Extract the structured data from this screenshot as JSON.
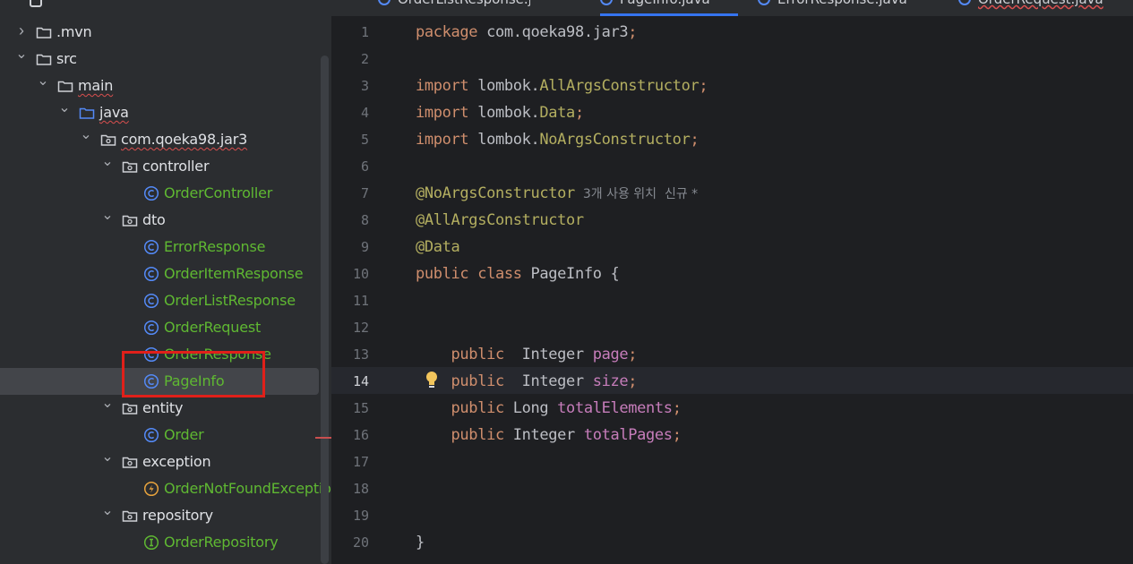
{
  "sidebar": {
    "tree": [
      {
        "label": ".mvn",
        "type": "folder",
        "depth": 0,
        "expanded": false
      },
      {
        "label": "src",
        "type": "folder",
        "depth": 0,
        "expanded": true
      },
      {
        "label": "main",
        "type": "folder",
        "depth": 1,
        "expanded": true,
        "underline": true
      },
      {
        "label": "java",
        "type": "source-folder",
        "depth": 2,
        "expanded": true,
        "underline": true
      },
      {
        "label": "com.qoeka98.jar3",
        "type": "package",
        "depth": 3,
        "expanded": true,
        "underline": true
      },
      {
        "label": "controller",
        "type": "package",
        "depth": 4,
        "expanded": true
      },
      {
        "label": "OrderController",
        "type": "class",
        "depth": 5
      },
      {
        "label": "dto",
        "type": "package",
        "depth": 4,
        "expanded": true
      },
      {
        "label": "ErrorResponse",
        "type": "class",
        "depth": 5
      },
      {
        "label": "OrderItemResponse",
        "type": "class",
        "depth": 5
      },
      {
        "label": "OrderListResponse",
        "type": "class",
        "depth": 5
      },
      {
        "label": "OrderRequest",
        "type": "class",
        "depth": 5
      },
      {
        "label": "OrderResponse",
        "type": "class",
        "depth": 5
      },
      {
        "label": "PageInfo",
        "type": "class",
        "depth": 5,
        "selected": true
      },
      {
        "label": "entity",
        "type": "package",
        "depth": 4,
        "expanded": true
      },
      {
        "label": "Order",
        "type": "class",
        "depth": 5
      },
      {
        "label": "exception",
        "type": "package",
        "depth": 4,
        "expanded": true
      },
      {
        "label": "OrderNotFoundException",
        "type": "exception",
        "depth": 5
      },
      {
        "label": "repository",
        "type": "package",
        "depth": 4,
        "expanded": true
      },
      {
        "label": "OrderRepository",
        "type": "interface",
        "depth": 5
      }
    ]
  },
  "editor": {
    "tabs": [
      {
        "label": "OrderListResponse.java",
        "active": false
      },
      {
        "label": "PageInfo.java",
        "active": true
      },
      {
        "label": "ErrorResponse.java",
        "active": false
      },
      {
        "label": "OrderRequest.java",
        "active": false,
        "error": true
      }
    ],
    "current_line": 14,
    "lines": [
      {
        "n": "1",
        "t": [
          [
            "package ",
            "kw"
          ],
          [
            "com.qoeka98.jar3",
            "tx"
          ],
          [
            ";",
            "kw"
          ]
        ]
      },
      {
        "n": "2",
        "t": []
      },
      {
        "n": "3",
        "t": [
          [
            "import ",
            "kw"
          ],
          [
            "lombok.",
            "tx"
          ],
          [
            "AllArgsConstructor",
            "an"
          ],
          [
            ";",
            "kw"
          ]
        ]
      },
      {
        "n": "4",
        "t": [
          [
            "import ",
            "kw"
          ],
          [
            "lombok.",
            "tx"
          ],
          [
            "Data",
            "an"
          ],
          [
            ";",
            "kw"
          ]
        ]
      },
      {
        "n": "5",
        "t": [
          [
            "import ",
            "kw"
          ],
          [
            "lombok.",
            "tx"
          ],
          [
            "NoArgsConstructor",
            "an"
          ],
          [
            ";",
            "kw"
          ]
        ]
      },
      {
        "n": "6",
        "t": []
      },
      {
        "n": "7",
        "t": [
          [
            "@NoArgsConstructor",
            "an"
          ],
          [
            "  3개 사용 위치  신규 *",
            "hint"
          ]
        ]
      },
      {
        "n": "8",
        "t": [
          [
            "@AllArgsConstructor",
            "an"
          ]
        ]
      },
      {
        "n": "9",
        "t": [
          [
            "@Data",
            "an"
          ]
        ]
      },
      {
        "n": "10",
        "t": [
          [
            "public ",
            "kw"
          ],
          [
            "class ",
            "kw"
          ],
          [
            "PageInfo {",
            "tx"
          ]
        ]
      },
      {
        "n": "11",
        "t": []
      },
      {
        "n": "12",
        "t": []
      },
      {
        "n": "13",
        "t": [
          [
            "    public  ",
            "kw"
          ],
          [
            "Integer ",
            "tx"
          ],
          [
            "page",
            "fd"
          ],
          [
            ";",
            "kw"
          ]
        ]
      },
      {
        "n": "14",
        "t": [
          [
            "    public  ",
            "kw"
          ],
          [
            "Integer ",
            "tx"
          ],
          [
            "size",
            "fd"
          ],
          [
            ";",
            "kw"
          ]
        ]
      },
      {
        "n": "15",
        "t": [
          [
            "    public ",
            "kw"
          ],
          [
            "Long ",
            "tx"
          ],
          [
            "totalElements",
            "fd"
          ],
          [
            ";",
            "kw"
          ]
        ]
      },
      {
        "n": "16",
        "t": [
          [
            "    public ",
            "kw"
          ],
          [
            "Integer ",
            "tx"
          ],
          [
            "totalPages",
            "fd"
          ],
          [
            ";",
            "kw"
          ]
        ]
      },
      {
        "n": "17",
        "t": []
      },
      {
        "n": "18",
        "t": []
      },
      {
        "n": "19",
        "t": []
      },
      {
        "n": "20",
        "t": [
          [
            "}",
            "tx"
          ]
        ]
      }
    ]
  },
  "icons": {
    "folder": "folder-icon",
    "source-folder": "source-folder-icon",
    "package": "package-icon",
    "class": "class-icon",
    "exception": "exception-class-icon",
    "interface": "interface-icon",
    "bulb": "lightbulb-icon"
  },
  "colors": {
    "class_text": "#5fb832",
    "keyword": "#cf8e6d",
    "annotation": "#b3ae60",
    "field": "#c77dbb",
    "highlight_box": "#e0201a",
    "tab_accent": "#3574f0"
  }
}
